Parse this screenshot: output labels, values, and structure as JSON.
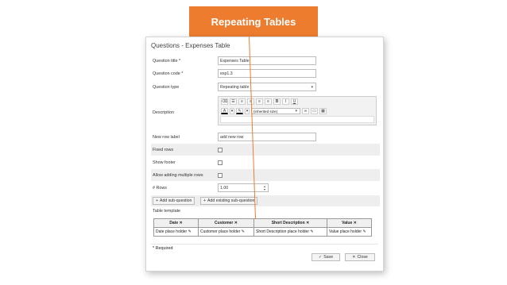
{
  "banner": {
    "text": "Repeating Tables"
  },
  "dialog": {
    "title": "Questions - Expenses Table",
    "fields": {
      "title_label": "Question title *",
      "title_value": "Expenses Table",
      "code_label": "Question code *",
      "code_value": "exp1.3",
      "type_label": "Question type",
      "type_value": "Repeating table",
      "description_label": "Description",
      "font_size_value": "(inherited size)",
      "new_row_label": "New row label",
      "new_row_value": "add new row",
      "fixed_rows_label": "Fixed rows",
      "show_footer_label": "Show footer",
      "allow_multiple_label": "Allow adding multiple rows",
      "rows_label": "# Rows",
      "rows_value": "1.00"
    },
    "buttons": {
      "add_sub": "Add sub-question",
      "add_existing": "Add existing sub-question",
      "save": "Save",
      "close": "Close"
    },
    "table_template_label": "Table template",
    "table": {
      "headers": [
        "Date",
        "Customer",
        "Short Description",
        "Value"
      ],
      "cells": [
        "Date place holder",
        "Customer place holder",
        "Short Description place holder",
        "Value place holder"
      ]
    },
    "required_note": "* Required"
  },
  "colors": {
    "accent": "#ed7c2f"
  }
}
